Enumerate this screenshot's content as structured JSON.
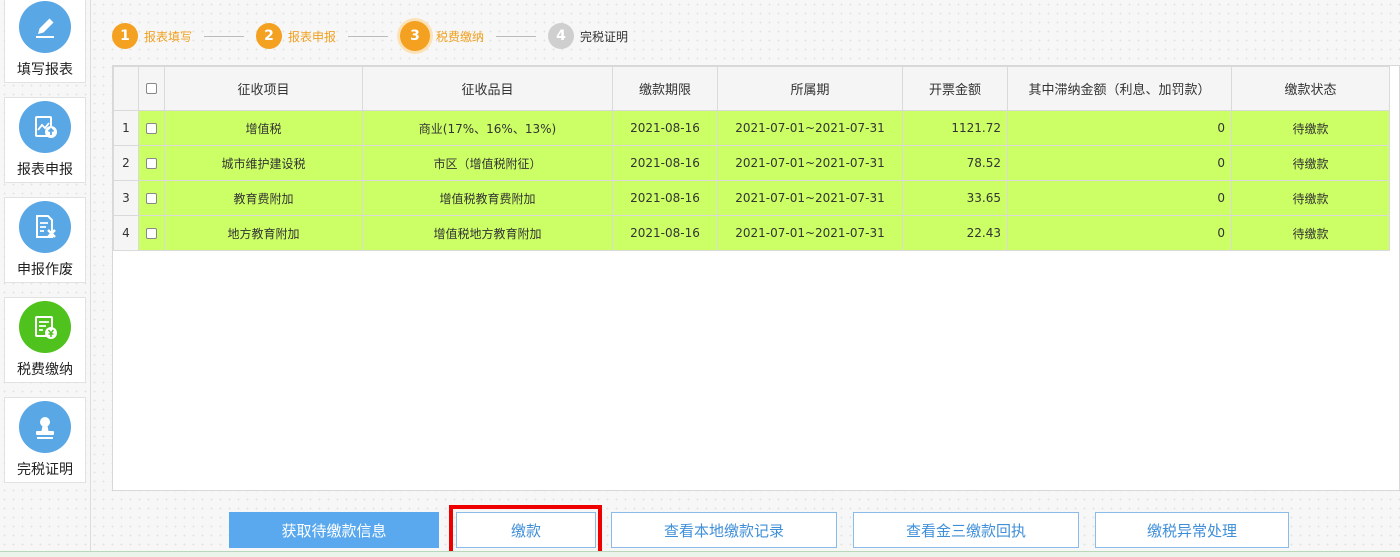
{
  "sidebar": {
    "items": [
      {
        "label": "填写报表",
        "icon": "pencil-icon",
        "active": false
      },
      {
        "label": "报表申报",
        "icon": "upload-report-icon",
        "active": false
      },
      {
        "label": "申报作废",
        "icon": "void-document-icon",
        "active": false
      },
      {
        "label": "税费缴纳",
        "icon": "tax-payment-icon",
        "active": true
      },
      {
        "label": "完税证明",
        "icon": "stamp-icon",
        "active": false
      }
    ]
  },
  "steps": [
    {
      "num": "1",
      "label": "报表填写"
    },
    {
      "num": "2",
      "label": "报表申报"
    },
    {
      "num": "3",
      "label": "税费缴纳"
    },
    {
      "num": "4",
      "label": "完税证明"
    }
  ],
  "table": {
    "headers": [
      "征收项目",
      "征收品目",
      "缴款期限",
      "所属期",
      "开票金额",
      "其中滞纳金额（利息、加罚款）",
      "缴款状态"
    ],
    "rows": [
      {
        "no": "1",
        "item": "增值税",
        "category": "商业(17%、16%、13%)",
        "deadline": "2021-08-16",
        "period": "2021-07-01~2021-07-31",
        "amount": "1121.72",
        "late_fee": "0",
        "status": "待缴款"
      },
      {
        "no": "2",
        "item": "城市维护建设税",
        "category": "市区（增值税附征）",
        "deadline": "2021-08-16",
        "period": "2021-07-01~2021-07-31",
        "amount": "78.52",
        "late_fee": "0",
        "status": "待缴款"
      },
      {
        "no": "3",
        "item": "教育费附加",
        "category": "增值税教育费附加",
        "deadline": "2021-08-16",
        "period": "2021-07-01~2021-07-31",
        "amount": "33.65",
        "late_fee": "0",
        "status": "待缴款"
      },
      {
        "no": "4",
        "item": "地方教育附加",
        "category": "增值税地方教育附加",
        "deadline": "2021-08-16",
        "period": "2021-07-01~2021-07-31",
        "amount": "22.43",
        "late_fee": "0",
        "status": "待缴款"
      }
    ]
  },
  "buttons": {
    "fetch": "获取待缴款信息",
    "pay": "缴款",
    "local_records": "查看本地缴款记录",
    "jinsan_receipt": "查看金三缴款回执",
    "exception": "缴税异常处理"
  },
  "colors": {
    "row_highlight": "#ccff66",
    "step_active": "#f4a020",
    "nav_icon": "#5aa7e6",
    "nav_icon_active": "#4fc21d",
    "primary_button": "#5aa9ee",
    "callout_box": "#ee0000"
  }
}
